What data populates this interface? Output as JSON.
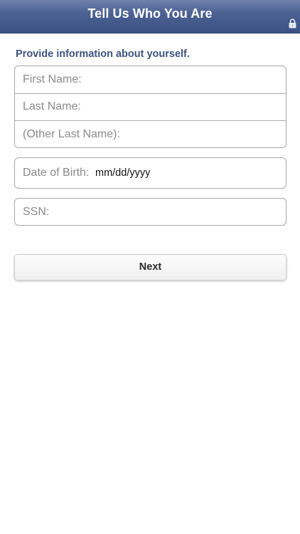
{
  "header": {
    "title": "Tell Us Who You Are",
    "icon": "lock-icon"
  },
  "form": {
    "intro": "Provide information about yourself.",
    "first_name": {
      "placeholder": "First Name:",
      "value": ""
    },
    "last_name": {
      "placeholder": "Last Name:",
      "value": ""
    },
    "other_last_name": {
      "placeholder": "(Other Last Name):",
      "value": ""
    },
    "dob": {
      "label": "Date of Birth:",
      "value": "mm/dd/yyyy"
    },
    "ssn": {
      "placeholder": "SSN:",
      "value": ""
    }
  },
  "actions": {
    "next_label": "Next"
  },
  "colors": {
    "header": "#4d6293",
    "intro_text": "#3e5380",
    "border": "#a9a9a9"
  }
}
